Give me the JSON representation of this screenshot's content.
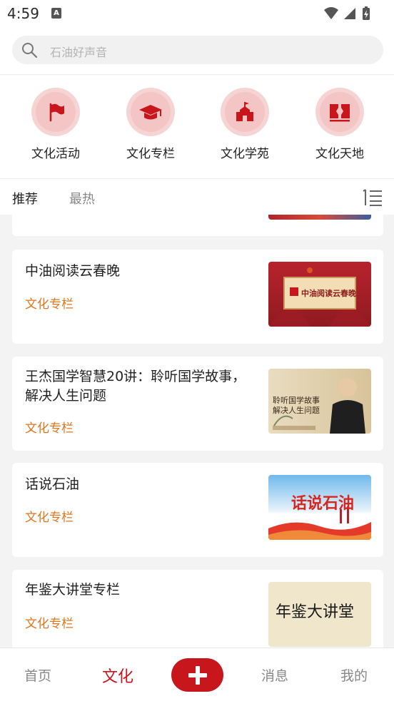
{
  "status_bar": {
    "time": "4:59",
    "notif_letter": "A"
  },
  "search": {
    "placeholder": "石油好声音"
  },
  "quick_links": [
    {
      "label": "文化活动",
      "icon": "flag-icon"
    },
    {
      "label": "文化专栏",
      "icon": "graduation-cap-icon"
    },
    {
      "label": "文化学苑",
      "icon": "school-building-icon"
    },
    {
      "label": "文化天地",
      "icon": "open-book-icon"
    }
  ],
  "tabs": {
    "active": "推荐",
    "inactive": "最热"
  },
  "feed": [
    {
      "title": "中油阅读云春晚",
      "tag": "文化专栏",
      "thumb_text": "中油阅读云春晚"
    },
    {
      "title": "王杰国学智慧20讲：聆听国学故事，解决人生问题",
      "tag": "文化专栏",
      "thumb_text": "聆听国学故事 解决人生问题"
    },
    {
      "title": "话说石油",
      "tag": "文化专栏",
      "thumb_text": "话说石油"
    },
    {
      "title": "年鉴大讲堂专栏",
      "tag": "文化专栏",
      "thumb_text": "年鉴大讲堂"
    }
  ],
  "bottom_nav": {
    "home": "首页",
    "culture": "文化",
    "messages": "消息",
    "mine": "我的"
  },
  "colors": {
    "accent": "#c8161d",
    "tag": "#e0761d",
    "icon_bg": "#f7d4d4"
  }
}
